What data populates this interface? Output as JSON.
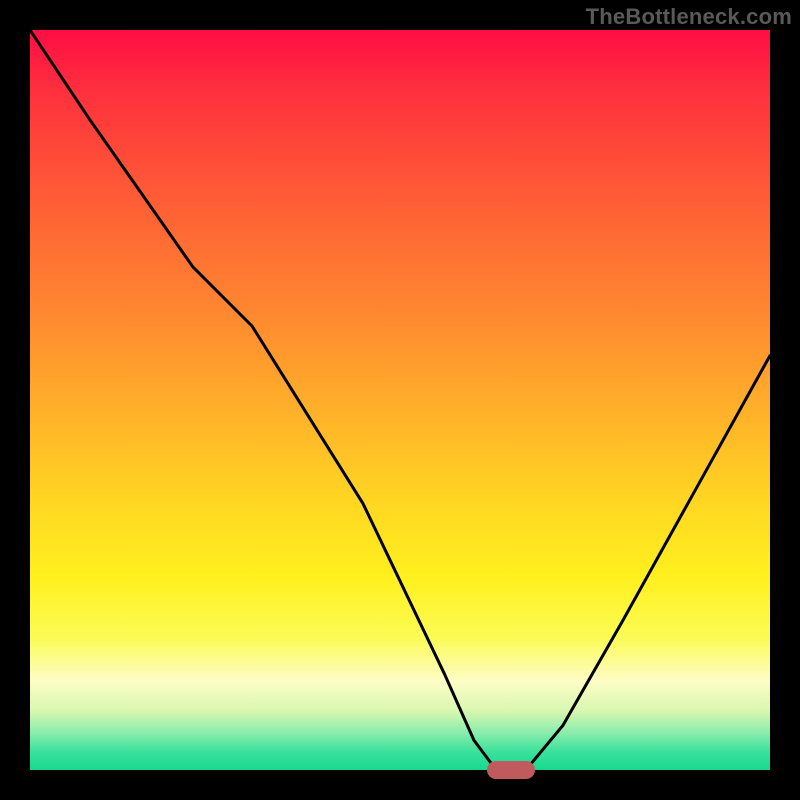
{
  "attribution": "TheBottleneck.com",
  "chart_data": {
    "type": "line",
    "title": "",
    "xlabel": "",
    "ylabel": "",
    "xlim": [
      0,
      100
    ],
    "ylim": [
      0,
      100
    ],
    "grid": false,
    "legend": false,
    "series": [
      {
        "name": "bottleneck-curve",
        "x": [
          0,
          8,
          22,
          30,
          45,
          56,
          60,
          63,
          67,
          72,
          80,
          90,
          100
        ],
        "values": [
          100,
          88,
          68,
          60,
          36,
          13,
          4,
          0,
          0,
          6,
          20,
          38,
          56
        ]
      }
    ],
    "marker": {
      "x": 65,
      "y": 0
    },
    "gradient_stops": [
      {
        "pct": 0,
        "color": "#ff0d43"
      },
      {
        "pct": 22,
        "color": "#ff5a36"
      },
      {
        "pct": 52,
        "color": "#ffb229"
      },
      {
        "pct": 74,
        "color": "#fff01e"
      },
      {
        "pct": 88,
        "color": "#fdfdc6"
      },
      {
        "pct": 97,
        "color": "#3be19c"
      },
      {
        "pct": 100,
        "color": "#17d98f"
      }
    ]
  }
}
